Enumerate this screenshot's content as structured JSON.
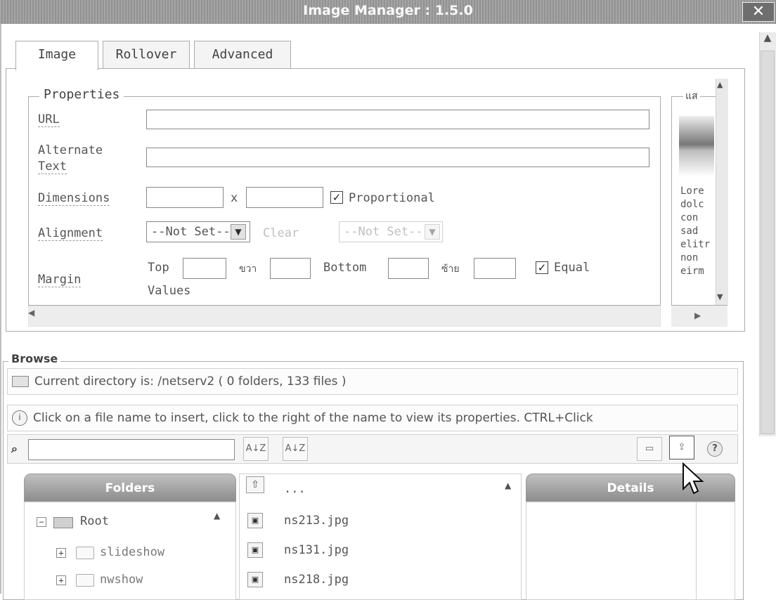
{
  "window": {
    "title": "Image Manager : 1.5.0",
    "close": "✕"
  },
  "tabs": [
    "Image",
    "Rollover",
    "Advanced"
  ],
  "properties": {
    "legend": "Properties",
    "url_label": "URL",
    "alt_label_line1": "Alternate",
    "alt_label_line2": "Text",
    "dimensions_label": "Dimensions",
    "dimensions_x": "x",
    "proportional_label": "Proportional",
    "alignment_label": "Alignment",
    "alignment_value": "--Not Set--",
    "clear_label": "Clear",
    "alignment2_value": "--Not Set--",
    "margin_label": "Margin",
    "margin_top": "Top",
    "margin_right": "ขวา",
    "margin_bottom": "Bottom",
    "margin_left": "ซ้าย",
    "equal_label": "Equal",
    "values_label": "Values"
  },
  "preview": {
    "legend": "แส",
    "text_lines": [
      "Lore",
      "dolc",
      "con",
      "sad",
      "elitr",
      "non",
      "eirm"
    ]
  },
  "browse": {
    "legend": "Browse",
    "current_dir": "Current directory is: /netserv2 ( 0 folders, 133 files )",
    "hint": "Click on a file name to insert, click to the right of the name to view its properties. CTRL+Click",
    "search_value": "",
    "folders_header": "Folders",
    "details_header": "Details",
    "folders": [
      {
        "label": "Root",
        "expander": "−"
      },
      {
        "label": "slideshow",
        "expander": "+"
      },
      {
        "label": "nwshow",
        "expander": "+"
      }
    ],
    "files": [
      "...",
      "ns213.jpg",
      "ns131.jpg",
      "ns218.jpg"
    ]
  }
}
